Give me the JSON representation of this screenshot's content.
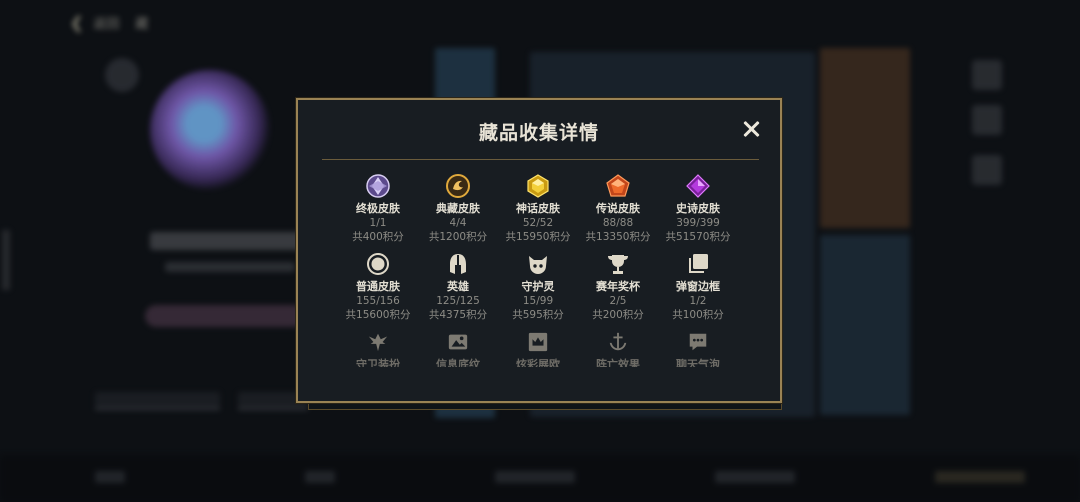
{
  "background": {
    "back_label": "返回",
    "tab_label": "藏"
  },
  "modal": {
    "title": "藏品收集详情",
    "rows": [
      [
        {
          "name": "终极皮肤",
          "count": "1/1",
          "points": "共400积分",
          "icon": "ultimate-gem-icon",
          "color": "#b9a6e0"
        },
        {
          "name": "典藏皮肤",
          "count": "4/4",
          "points": "共1200积分",
          "icon": "prestige-emblem-icon",
          "color": "#d8a23a"
        },
        {
          "name": "神话皮肤",
          "count": "52/52",
          "points": "共15950积分",
          "icon": "mythic-gem-icon",
          "color": "#e6c22c"
        },
        {
          "name": "传说皮肤",
          "count": "88/88",
          "points": "共13350积分",
          "icon": "legendary-gem-icon",
          "color": "#e2642a"
        },
        {
          "name": "史诗皮肤",
          "count": "399/399",
          "points": "共51570积分",
          "icon": "epic-gem-icon",
          "color": "#b23ad8"
        }
      ],
      [
        {
          "name": "普通皮肤",
          "count": "155/156",
          "points": "共15600积分",
          "icon": "standard-ring-icon",
          "color": "#ded8c8"
        },
        {
          "name": "英雄",
          "count": "125/125",
          "points": "共4375积分",
          "icon": "champion-helmet-icon",
          "color": "#ded8c8"
        },
        {
          "name": "守护灵",
          "count": "15/99",
          "points": "共595积分",
          "icon": "guardian-pet-icon",
          "color": "#ded8c8"
        },
        {
          "name": "赛年奖杯",
          "count": "2/5",
          "points": "共200积分",
          "icon": "trophy-icon",
          "color": "#ded8c8"
        },
        {
          "name": "弹窗边框",
          "count": "1/2",
          "points": "共100积分",
          "icon": "frame-stack-icon",
          "color": "#ded8c8"
        }
      ],
      [
        {
          "name": "守卫装扮",
          "icon": "ward-skin-icon",
          "color": "#7d7a72"
        },
        {
          "name": "信息底纹",
          "icon": "banner-pattern-icon",
          "color": "#7d7a72"
        },
        {
          "name": "炫彩展欧",
          "icon": "crown-panel-icon",
          "color": "#7d7a72"
        },
        {
          "name": "阵亡效果",
          "icon": "anchor-icon",
          "color": "#7d7a72"
        },
        {
          "name": "聊天气泡",
          "icon": "chat-bubble-icon",
          "color": "#7d7a72"
        }
      ]
    ]
  }
}
